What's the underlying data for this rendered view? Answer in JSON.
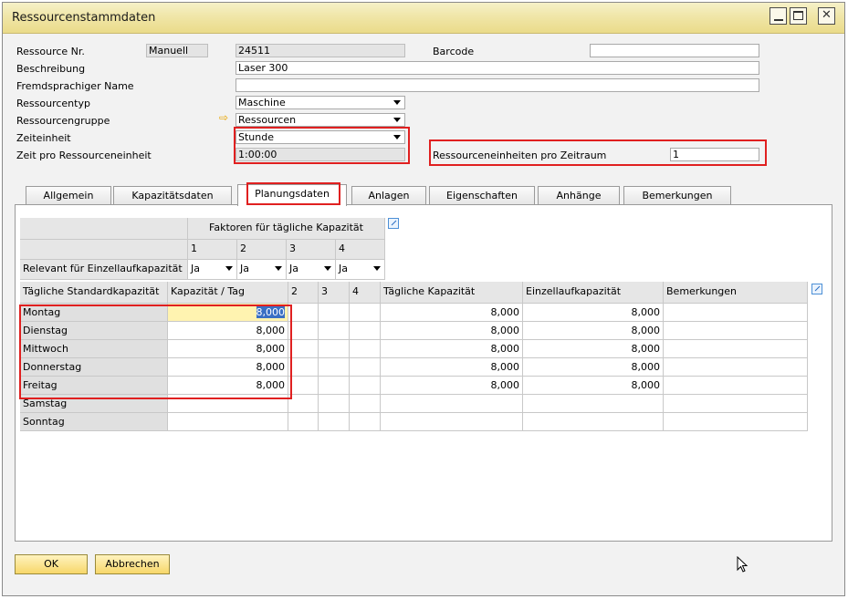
{
  "window": {
    "title": "Ressourcenstammdaten",
    "controls": {
      "minimize": "_",
      "maximize": "□",
      "close": "✕"
    }
  },
  "header": {
    "ressource_nr": {
      "label": "Ressource Nr.",
      "series": "Manuell",
      "value": "24511"
    },
    "barcode": {
      "label": "Barcode",
      "value": ""
    },
    "beschreibung": {
      "label": "Beschreibung",
      "value": "Laser 300"
    },
    "fremdsprachiger_name": {
      "label": "Fremdsprachiger Name",
      "value": ""
    },
    "ressourcentyp": {
      "label": "Ressourcentyp",
      "value": "Maschine"
    },
    "ressourcengruppe": {
      "label": "Ressourcengruppe",
      "value": "Ressourcen"
    },
    "zeiteinheit": {
      "label": "Zeiteinheit",
      "value": "Stunde"
    },
    "zeit_pro_einheit": {
      "label": "Zeit pro Ressourceneinheit",
      "value": "1:00:00"
    },
    "einheiten_pro_zeitraum": {
      "label": "Ressourceneinheiten pro Zeitraum",
      "value": "1"
    }
  },
  "tabs": [
    {
      "label": "Allgemein"
    },
    {
      "label": "Kapazitätsdaten"
    },
    {
      "label": "Planungsdaten",
      "active": true
    },
    {
      "label": "Anlagen"
    },
    {
      "label": "Eigenschaften"
    },
    {
      "label": "Anhänge"
    },
    {
      "label": "Bemerkungen"
    }
  ],
  "factors": {
    "title": "Faktoren für tägliche Kapazität",
    "columns": [
      "1",
      "2",
      "3",
      "4"
    ],
    "relevant_label": "Relevant für Einzellaufkapazität",
    "relevant_values": [
      "Ja",
      "Ja",
      "Ja",
      "Ja"
    ]
  },
  "table": {
    "headers": [
      "Tägliche Standardkapazität",
      "Kapazität / Tag",
      "2",
      "3",
      "4",
      "Tägliche Kapazität",
      "Einzellaufkapazität",
      "Bemerkungen"
    ],
    "rows": [
      {
        "day": "Montag",
        "kap": "8,000",
        "c2": "",
        "c3": "",
        "c4": "",
        "taeglich": "8,000",
        "einzel": "8,000",
        "bem": ""
      },
      {
        "day": "Dienstag",
        "kap": "8,000",
        "c2": "",
        "c3": "",
        "c4": "",
        "taeglich": "8,000",
        "einzel": "8,000",
        "bem": ""
      },
      {
        "day": "Mittwoch",
        "kap": "8,000",
        "c2": "",
        "c3": "",
        "c4": "",
        "taeglich": "8,000",
        "einzel": "8,000",
        "bem": ""
      },
      {
        "day": "Donnerstag",
        "kap": "8,000",
        "c2": "",
        "c3": "",
        "c4": "",
        "taeglich": "8,000",
        "einzel": "8,000",
        "bem": ""
      },
      {
        "day": "Freitag",
        "kap": "8,000",
        "c2": "",
        "c3": "",
        "c4": "",
        "taeglich": "8,000",
        "einzel": "8,000",
        "bem": ""
      },
      {
        "day": "Samstag",
        "kap": "",
        "c2": "",
        "c3": "",
        "c4": "",
        "taeglich": "",
        "einzel": "",
        "bem": ""
      },
      {
        "day": "Sonntag",
        "kap": "",
        "c2": "",
        "c3": "",
        "c4": "",
        "taeglich": "",
        "einzel": "",
        "bem": ""
      }
    ]
  },
  "buttons": {
    "ok": "OK",
    "cancel": "Abbrechen"
  },
  "colors": {
    "highlight": "#e02020",
    "button": "#f7d76a",
    "titlebar": "#f0e6a8"
  }
}
